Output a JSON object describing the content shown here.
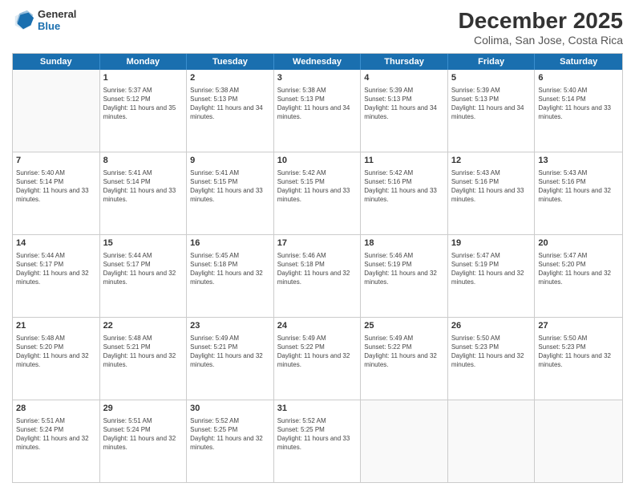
{
  "header": {
    "logo_line1": "General",
    "logo_line2": "Blue",
    "title": "December 2025",
    "subtitle": "Colima, San Jose, Costa Rica"
  },
  "days": [
    "Sunday",
    "Monday",
    "Tuesday",
    "Wednesday",
    "Thursday",
    "Friday",
    "Saturday"
  ],
  "weeks": [
    [
      {
        "day": "",
        "empty": true
      },
      {
        "day": "1",
        "sunrise": "5:37 AM",
        "sunset": "5:12 PM",
        "daylight": "11 hours and 35 minutes."
      },
      {
        "day": "2",
        "sunrise": "5:38 AM",
        "sunset": "5:13 PM",
        "daylight": "11 hours and 34 minutes."
      },
      {
        "day": "3",
        "sunrise": "5:38 AM",
        "sunset": "5:13 PM",
        "daylight": "11 hours and 34 minutes."
      },
      {
        "day": "4",
        "sunrise": "5:39 AM",
        "sunset": "5:13 PM",
        "daylight": "11 hours and 34 minutes."
      },
      {
        "day": "5",
        "sunrise": "5:39 AM",
        "sunset": "5:13 PM",
        "daylight": "11 hours and 34 minutes."
      },
      {
        "day": "6",
        "sunrise": "5:40 AM",
        "sunset": "5:14 PM",
        "daylight": "11 hours and 33 minutes."
      }
    ],
    [
      {
        "day": "7",
        "sunrise": "5:40 AM",
        "sunset": "5:14 PM",
        "daylight": "11 hours and 33 minutes."
      },
      {
        "day": "8",
        "sunrise": "5:41 AM",
        "sunset": "5:14 PM",
        "daylight": "11 hours and 33 minutes."
      },
      {
        "day": "9",
        "sunrise": "5:41 AM",
        "sunset": "5:15 PM",
        "daylight": "11 hours and 33 minutes."
      },
      {
        "day": "10",
        "sunrise": "5:42 AM",
        "sunset": "5:15 PM",
        "daylight": "11 hours and 33 minutes."
      },
      {
        "day": "11",
        "sunrise": "5:42 AM",
        "sunset": "5:16 PM",
        "daylight": "11 hours and 33 minutes."
      },
      {
        "day": "12",
        "sunrise": "5:43 AM",
        "sunset": "5:16 PM",
        "daylight": "11 hours and 33 minutes."
      },
      {
        "day": "13",
        "sunrise": "5:43 AM",
        "sunset": "5:16 PM",
        "daylight": "11 hours and 32 minutes."
      }
    ],
    [
      {
        "day": "14",
        "sunrise": "5:44 AM",
        "sunset": "5:17 PM",
        "daylight": "11 hours and 32 minutes."
      },
      {
        "day": "15",
        "sunrise": "5:44 AM",
        "sunset": "5:17 PM",
        "daylight": "11 hours and 32 minutes."
      },
      {
        "day": "16",
        "sunrise": "5:45 AM",
        "sunset": "5:18 PM",
        "daylight": "11 hours and 32 minutes."
      },
      {
        "day": "17",
        "sunrise": "5:46 AM",
        "sunset": "5:18 PM",
        "daylight": "11 hours and 32 minutes."
      },
      {
        "day": "18",
        "sunrise": "5:46 AM",
        "sunset": "5:19 PM",
        "daylight": "11 hours and 32 minutes."
      },
      {
        "day": "19",
        "sunrise": "5:47 AM",
        "sunset": "5:19 PM",
        "daylight": "11 hours and 32 minutes."
      },
      {
        "day": "20",
        "sunrise": "5:47 AM",
        "sunset": "5:20 PM",
        "daylight": "11 hours and 32 minutes."
      }
    ],
    [
      {
        "day": "21",
        "sunrise": "5:48 AM",
        "sunset": "5:20 PM",
        "daylight": "11 hours and 32 minutes."
      },
      {
        "day": "22",
        "sunrise": "5:48 AM",
        "sunset": "5:21 PM",
        "daylight": "11 hours and 32 minutes."
      },
      {
        "day": "23",
        "sunrise": "5:49 AM",
        "sunset": "5:21 PM",
        "daylight": "11 hours and 32 minutes."
      },
      {
        "day": "24",
        "sunrise": "5:49 AM",
        "sunset": "5:22 PM",
        "daylight": "11 hours and 32 minutes."
      },
      {
        "day": "25",
        "sunrise": "5:49 AM",
        "sunset": "5:22 PM",
        "daylight": "11 hours and 32 minutes."
      },
      {
        "day": "26",
        "sunrise": "5:50 AM",
        "sunset": "5:23 PM",
        "daylight": "11 hours and 32 minutes."
      },
      {
        "day": "27",
        "sunrise": "5:50 AM",
        "sunset": "5:23 PM",
        "daylight": "11 hours and 32 minutes."
      }
    ],
    [
      {
        "day": "28",
        "sunrise": "5:51 AM",
        "sunset": "5:24 PM",
        "daylight": "11 hours and 32 minutes."
      },
      {
        "day": "29",
        "sunrise": "5:51 AM",
        "sunset": "5:24 PM",
        "daylight": "11 hours and 32 minutes."
      },
      {
        "day": "30",
        "sunrise": "5:52 AM",
        "sunset": "5:25 PM",
        "daylight": "11 hours and 32 minutes."
      },
      {
        "day": "31",
        "sunrise": "5:52 AM",
        "sunset": "5:25 PM",
        "daylight": "11 hours and 33 minutes."
      },
      {
        "day": "",
        "empty": true
      },
      {
        "day": "",
        "empty": true
      },
      {
        "day": "",
        "empty": true
      }
    ]
  ]
}
